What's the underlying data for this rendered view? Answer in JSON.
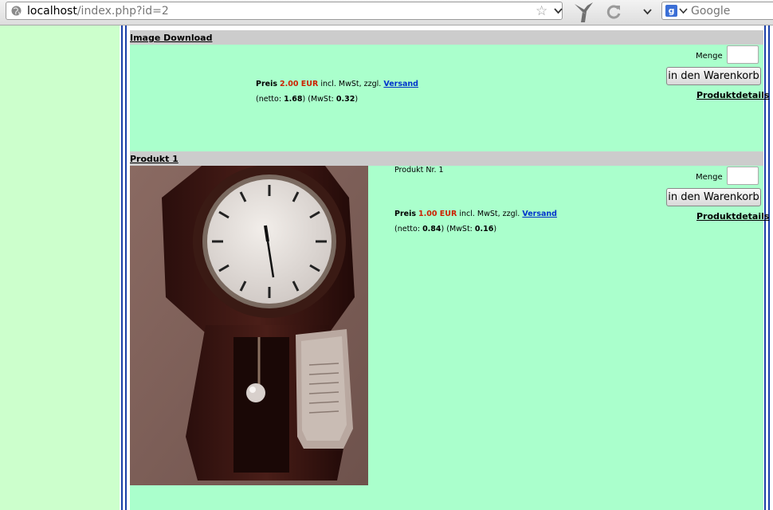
{
  "browser": {
    "url_host": "localhost",
    "url_path": "/index.php?id=2",
    "search_placeholder": "Google",
    "search_engine_badge": "g"
  },
  "colors": {
    "page_left": "#ccffcc",
    "product_bg": "#aaffcc",
    "header_bg": "#cccccc",
    "price_red": "#cc2200",
    "link_blue": "#0033cc",
    "frame_blue": "#1a3fa8"
  },
  "products": [
    {
      "name": "Image Download",
      "price_label": "Preis",
      "price": "2.00 EUR",
      "tax_text": "incl. MwSt, zzgl.",
      "shipping_link": "Versand",
      "netto_prefix": "(netto: ",
      "netto_value": "1.68",
      "mwst_prefix": ") (MwSt: ",
      "mwst_value": "0.32",
      "closing": ")",
      "quantity_label": "Menge",
      "cart_button": "in den Warenkorb",
      "details_link": "Produktdetails"
    },
    {
      "name": "Produkt 1",
      "product_number": "Produkt Nr. 1",
      "price_label": "Preis",
      "price": "1.00 EUR",
      "tax_text": "incl. MwSt, zzgl.",
      "shipping_link": "Versand",
      "netto_prefix": "(netto: ",
      "netto_value": "0.84",
      "mwst_prefix": ") (MwSt: ",
      "mwst_value": "0.16",
      "closing": ")",
      "quantity_label": "Menge",
      "cart_button": "in den Warenkorb",
      "details_link": "Produktdetails",
      "image": "wall-clock-photo"
    }
  ]
}
